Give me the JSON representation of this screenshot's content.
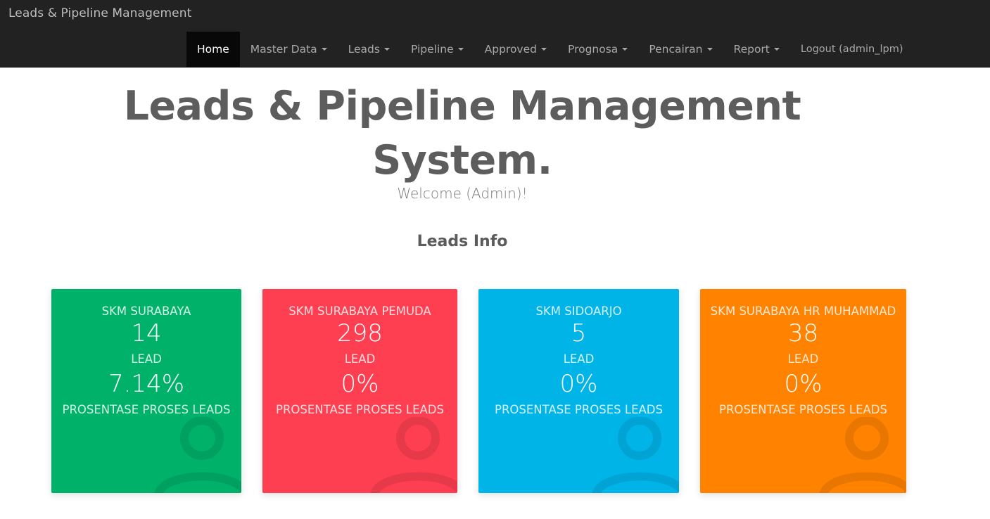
{
  "app": {
    "brand": "Leads & Pipeline Management"
  },
  "nav": {
    "items": [
      {
        "label": "Home",
        "dropdown": false,
        "active": true
      },
      {
        "label": "Master Data",
        "dropdown": true
      },
      {
        "label": "Leads",
        "dropdown": true
      },
      {
        "label": "Pipeline",
        "dropdown": true
      },
      {
        "label": "Approved",
        "dropdown": true
      },
      {
        "label": "Prognosa",
        "dropdown": true
      },
      {
        "label": "Pencairan",
        "dropdown": true
      },
      {
        "label": "Report",
        "dropdown": true
      },
      {
        "label": "Logout (admin_lpm)",
        "dropdown": false
      }
    ]
  },
  "hero": {
    "title_line1": "Leads & Pipeline Management",
    "title_line2": "System.",
    "welcome": "Welcome (Admin)!"
  },
  "section": {
    "title": "Leads Info"
  },
  "cards": [
    {
      "branch": "SKM SURABAYA",
      "count": "14",
      "count_label": "LEAD",
      "percent": "7.14%",
      "percent_label": "PROSENTASE PROSES LEADS",
      "color": "#00b16a"
    },
    {
      "branch": "SKM SURABAYA PEMUDA",
      "count": "298",
      "count_label": "LEAD",
      "percent": "0%",
      "percent_label": "PROSENTASE PROSES LEADS",
      "color": "#fd3f51"
    },
    {
      "branch": "SKM SIDOARJO",
      "count": "5",
      "count_label": "LEAD",
      "percent": "0%",
      "percent_label": "PROSENTASE PROSES LEADS",
      "color": "#00b4e8"
    },
    {
      "branch": "SKM SURABAYA HR MUHAMMAD",
      "count": "38",
      "count_label": "LEAD",
      "percent": "0%",
      "percent_label": "PROSENTASE PROSES LEADS",
      "color": "#ff8200"
    }
  ],
  "icons": {
    "card_icon": "user-icon",
    "dropdown_icon": "caret-down-icon"
  }
}
